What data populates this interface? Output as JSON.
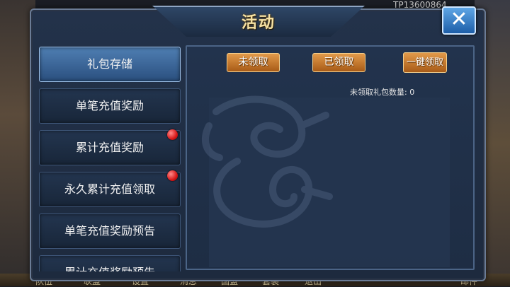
{
  "background": {
    "top_text": "TP13600864",
    "bottom_bar": [
      "队伍",
      "联盟",
      "设置",
      "消息",
      "国盟",
      "套装",
      "退出",
      "邮件"
    ]
  },
  "window": {
    "title": "活动",
    "close_label": "✕"
  },
  "menu": {
    "items": [
      {
        "label": "礼包存储",
        "active": true,
        "badge": false
      },
      {
        "label": "单笔充值奖励",
        "active": false,
        "badge": false
      },
      {
        "label": "累计充值奖励",
        "active": false,
        "badge": true
      },
      {
        "label": "永久累计充值领取",
        "active": false,
        "badge": true
      },
      {
        "label": "单笔充值奖励预告",
        "active": false,
        "badge": false
      },
      {
        "label": "累计充值奖励预告",
        "active": false,
        "badge": false
      }
    ]
  },
  "panel": {
    "tabs": [
      {
        "label": "未领取"
      },
      {
        "label": "已领取"
      },
      {
        "label": "一键领取"
      }
    ],
    "unclaimed_count_label": "未领取礼包数量: 0"
  },
  "colors": {
    "accent": "#f6e2a4",
    "tab_orange": "#e29a4a",
    "badge_red": "#d71818",
    "close_blue": "#1d5ea8"
  }
}
